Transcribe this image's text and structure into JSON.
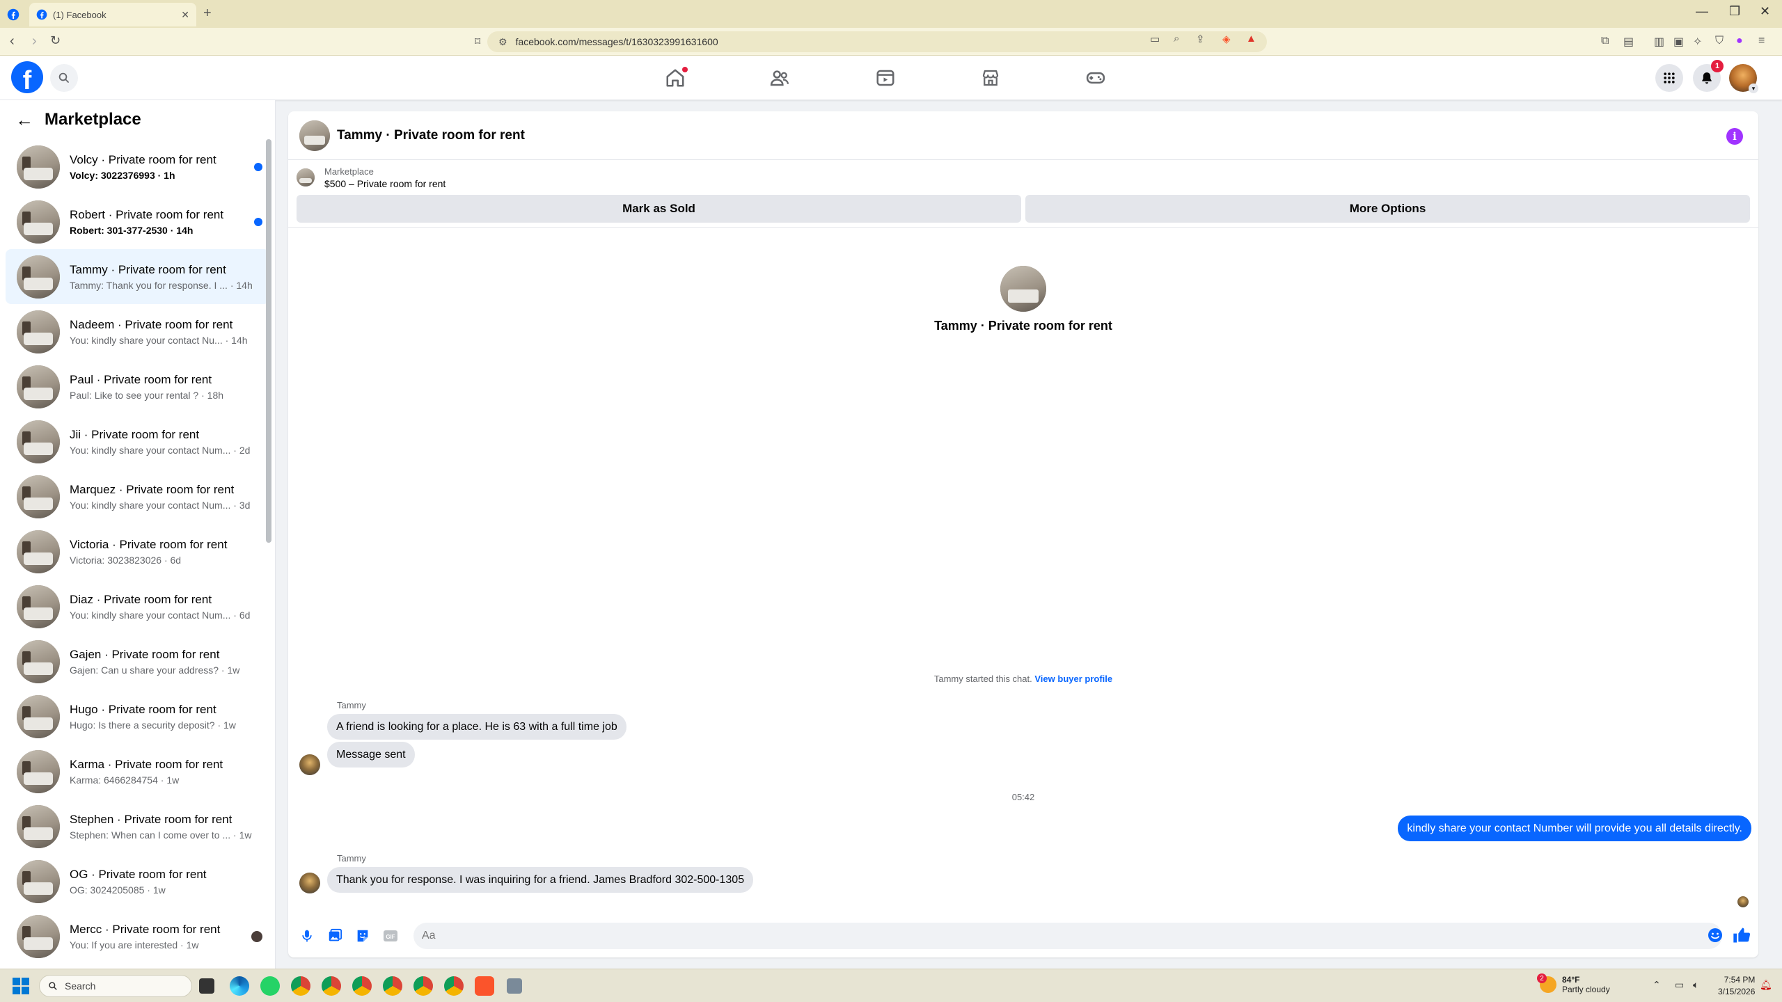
{
  "browser": {
    "tab_title": "(1) Facebook",
    "url": "facebook.com/messages/t/1630323991631600"
  },
  "fbnav": {
    "notification_count": "1"
  },
  "sidebar": {
    "title": "Marketplace",
    "conversations": [
      {
        "name": "Volcy · Private room for rent",
        "preview": "Volcy: 3022376993 · 1h",
        "unread": true
      },
      {
        "name": "Robert · Private room for rent",
        "preview": "Robert: 301-377-2530 · 14h",
        "unread": true
      },
      {
        "name": "Tammy · Private room for rent",
        "preview": "Tammy: Thank you for response. I ... · 14h",
        "active": true
      },
      {
        "name": "Nadeem · Private room for rent",
        "preview": "You: kindly share your contact Nu... · 14h"
      },
      {
        "name": "Paul · Private room for rent",
        "preview": "Paul: Like to see your rental ? · 18h"
      },
      {
        "name": "Jii · Private room for rent",
        "preview": "You: kindly share your contact Num... · 2d"
      },
      {
        "name": "Marquez · Private room for rent",
        "preview": "You: kindly share your contact Num... · 3d"
      },
      {
        "name": "Victoria · Private room for rent",
        "preview": "Victoria: 3023823026 · 6d"
      },
      {
        "name": "Diaz · Private room for rent",
        "preview": "You: kindly share your contact Num... · 6d"
      },
      {
        "name": "Gajen · Private room for rent",
        "preview": "Gajen: Can u share your address? · 1w"
      },
      {
        "name": "Hugo · Private room for rent",
        "preview": "Hugo: Is there a security deposit? · 1w"
      },
      {
        "name": "Karma · Private room for rent",
        "preview": "Karma: 6466284754 · 1w"
      },
      {
        "name": "Stephen · Private room for rent",
        "preview": "Stephen: When can I come over to ... · 1w"
      },
      {
        "name": "OG · Private room for rent",
        "preview": "OG: 3024205085 · 1w"
      },
      {
        "name": "Mercc · Private room for rent",
        "preview": "You: If you are interested · 1w",
        "seen": true
      }
    ]
  },
  "chat": {
    "title": "Tammy · Private room for rent",
    "listing_label": "Marketplace",
    "listing_title": "$500 – Private room for rent",
    "mark_sold_label": "Mark as Sold",
    "more_options_label": "More Options",
    "intro_name": "Tammy · Private room for rent",
    "started_text": "Tammy started this chat.",
    "view_profile_label": "View buyer profile",
    "sender_name_1": "Tammy",
    "msg_1": "A friend is looking for a place. He is 63 with a full time job",
    "msg_2": "Message sent",
    "timestamp": "05:42",
    "msg_out": "kindly share your contact Number will provide you all details directly.",
    "sender_name_2": "Tammy",
    "msg_3": "Thank you for response. I was inquiring for a friend.  James Bradford 302-500-1305",
    "input_placeholder": "Aa"
  },
  "taskbar": {
    "search_label": "Search",
    "weather_temp": "84°F",
    "weather_desc": "Partly cloudy",
    "weather_badge": "2",
    "time": "7:54 PM",
    "date": "3/15/2026"
  },
  "colors": {
    "fb_blue": "#0866ff",
    "unread_dot": "#0866ff",
    "info_purple": "#a033ff"
  }
}
